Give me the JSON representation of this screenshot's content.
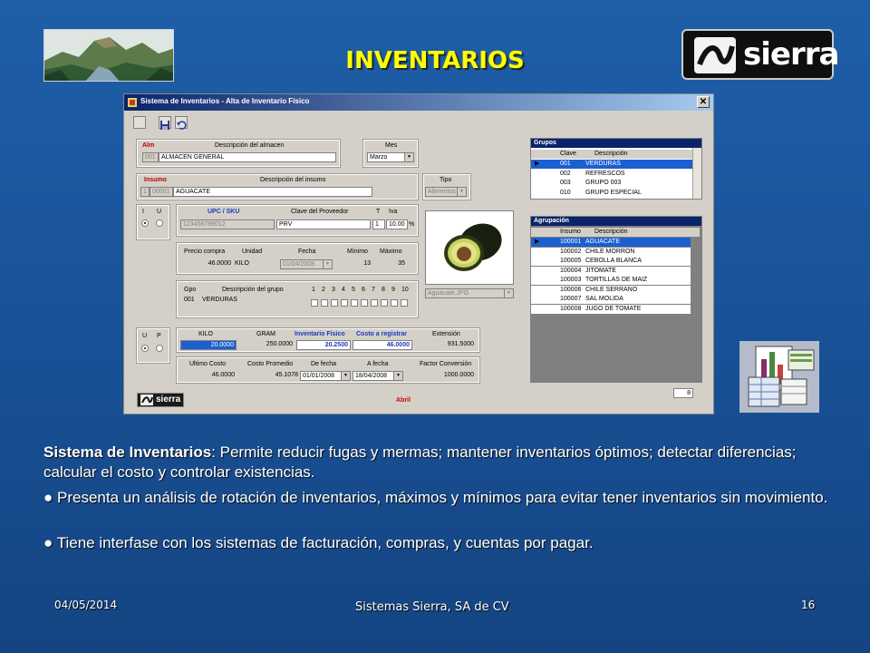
{
  "slide": {
    "title": "INVENTARIOS",
    "logo_text": "sierra",
    "colors": {
      "background": "#1a5399",
      "title": "#ffff00",
      "text": "#ffffff"
    }
  },
  "window": {
    "title": "Sistema de Inventarios - Alta de Inventario Físico",
    "close_glyph": "✕",
    "almacen": {
      "alm_label": "Alm",
      "desc_label": "Descripción del almacen",
      "code": "001",
      "desc": "ALMACEN GENERAL"
    },
    "mes": {
      "label": "Mes",
      "value": "Marzo"
    },
    "insumo": {
      "label": "Insumo",
      "desc_label": "Descripción del insumo",
      "num": "1",
      "code": "00001",
      "desc": "AGUACATE"
    },
    "tipo": {
      "label": "Tipo",
      "value": "Alimentos"
    },
    "iu": {
      "i": "I",
      "u": "U"
    },
    "upc": {
      "upc_label": "UPC / SKU",
      "prov_label": "Clave del Proveedor",
      "t_label": "T",
      "iva_label": "Iva",
      "upc_value": "123456789012",
      "prov_value": "PRV",
      "t_value": "1",
      "iva_value": "10.00",
      "pct": "%"
    },
    "precio": {
      "precio_label": "Precio compra",
      "unidad_label": "Unidad",
      "fecha_label": "Fecha",
      "min_label": "Mínimo",
      "max_label": "Máximo",
      "precio_value": "46.0000",
      "unidad_value": "KILO",
      "fecha_value": "01/04/2008",
      "min_value": "13",
      "max_value": "35"
    },
    "gpo": {
      "gpo_label": "Gpo",
      "desc_label": "Descripción del grupo",
      "code": "001",
      "desc": "VERDURAS",
      "digits": [
        "1",
        "2",
        "3",
        "4",
        "5",
        "6",
        "7",
        "8",
        "9",
        "10"
      ]
    },
    "image_file": "Aguacate.JPG",
    "up": {
      "u": "U",
      "p": "P"
    },
    "medidas": {
      "kilo_label": "KILO",
      "gram_label": "GRAM",
      "fisico_label": "Inventario Físico",
      "costo_label": "Costo a registrar",
      "ext_label": "Extensión",
      "kilo_value": "20.0000",
      "gram_value": "250.0000",
      "fisico_value": "20.2500",
      "costo_value": "46.0000",
      "ext_value": "931.5000"
    },
    "costos": {
      "ult_label": "Ultimo Costo",
      "prom_label": "Costo Promedio",
      "de_label": "De fecha",
      "a_label": "A fecha",
      "factor_label": "Factor Conversión",
      "ult_value": "46.0000",
      "prom_value": "45.1078",
      "de_value": "01/01/2008",
      "a_value": "18/04/2008",
      "factor_value": "1000.0000"
    },
    "grupos": {
      "caption": "Grupos",
      "col_clave": "Clave",
      "col_desc": "Descripción",
      "rows": [
        {
          "marker": "▶",
          "clave": "001",
          "desc": "VERDURAS"
        },
        {
          "marker": "",
          "clave": "002",
          "desc": "REFRESCOS"
        },
        {
          "marker": "",
          "clave": "003",
          "desc": "GRUPO 003"
        },
        {
          "marker": "",
          "clave": "010",
          "desc": "GRUPO ESPECIAL"
        }
      ]
    },
    "agrupacion": {
      "caption": "Agrupación",
      "col_insumo": "Insumo",
      "col_desc": "Descripción",
      "rows": [
        {
          "marker": "▶",
          "insumo": "100001",
          "desc": "AGUACATE"
        },
        {
          "marker": "",
          "insumo": "100002",
          "desc": "CHILE MORRON"
        },
        {
          "marker": "",
          "insumo": "100005",
          "desc": "CEBOLLA BLANCA"
        },
        {
          "marker": "",
          "insumo": "100004",
          "desc": "JITOMATE"
        },
        {
          "marker": "",
          "insumo": "100003",
          "desc": "TORTILLAS DE MAIZ"
        },
        {
          "marker": "",
          "insumo": "100006",
          "desc": "CHILE SERRANO"
        },
        {
          "marker": "",
          "insumo": "100007",
          "desc": "SAL MOLIDA"
        },
        {
          "marker": "",
          "insumo": "100008",
          "desc": "JUGO DE TOMATE"
        }
      ]
    },
    "footer_month": "Abril",
    "footer_logo": "sierra",
    "page_number": "8"
  },
  "body": {
    "para1_bold": "Sistema de Inventarios",
    "para1_rest": ": Permite reducir fugas y mermas; mantener inventarios óptimos; detectar diferencias; calcular el costo y controlar existencias.",
    "bullet_glyph": "●",
    "bullet1": "Presenta un análisis de rotación de inventarios, máximos y mínimos para evitar tener inventarios sin movimiento.",
    "bullet2": "Tiene interfase con los sistemas de facturación, compras, y cuentas por pagar."
  },
  "footer": {
    "date": "04/05/2014",
    "company": "Sistemas Sierra, SA de CV",
    "slide_number": "16"
  }
}
